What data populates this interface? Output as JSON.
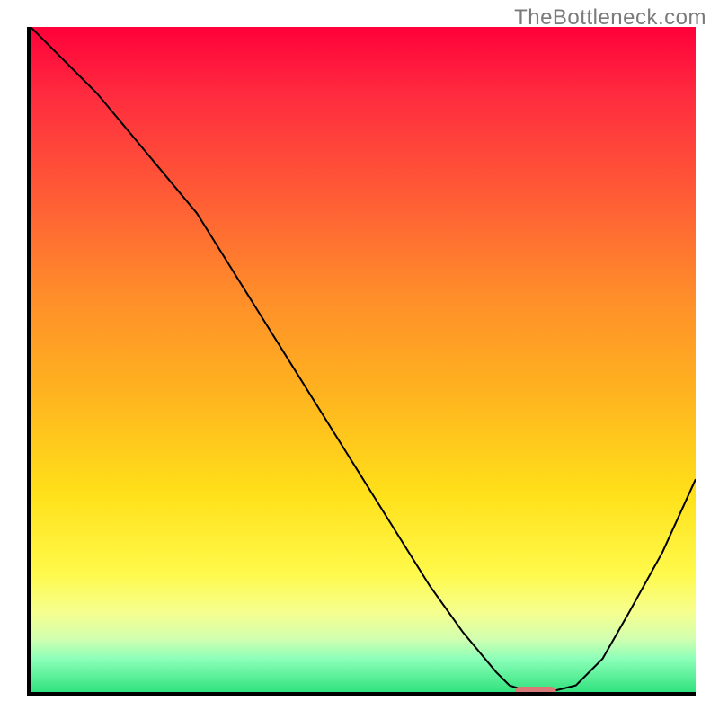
{
  "watermark": "TheBottleneck.com",
  "chart_data": {
    "type": "line",
    "title": "",
    "xlabel": "",
    "ylabel": "",
    "xlim": [
      0,
      100
    ],
    "ylim": [
      0,
      100
    ],
    "x": [
      0,
      5,
      10,
      15,
      20,
      25,
      30,
      35,
      40,
      45,
      50,
      55,
      60,
      65,
      70,
      72,
      75,
      78,
      82,
      86,
      90,
      95,
      100
    ],
    "values": [
      100,
      95,
      90,
      84,
      78,
      72,
      64,
      56,
      48,
      40,
      32,
      24,
      16,
      9,
      3,
      1,
      0,
      0,
      1,
      5,
      12,
      21,
      32
    ],
    "minimum_marker_x": 76,
    "gradient_stops": [
      {
        "pos": 0,
        "color": "#ff003a"
      },
      {
        "pos": 10,
        "color": "#ff2b3f"
      },
      {
        "pos": 25,
        "color": "#ff5a36"
      },
      {
        "pos": 40,
        "color": "#ff8c2a"
      },
      {
        "pos": 55,
        "color": "#ffb31f"
      },
      {
        "pos": 70,
        "color": "#ffe019"
      },
      {
        "pos": 82,
        "color": "#fff94a"
      },
      {
        "pos": 88,
        "color": "#f6ff8e"
      },
      {
        "pos": 92,
        "color": "#d2ffb0"
      },
      {
        "pos": 95,
        "color": "#8cffb8"
      },
      {
        "pos": 100,
        "color": "#31e27e"
      }
    ],
    "axes_visible": {
      "ticks": false,
      "grid": false
    }
  }
}
